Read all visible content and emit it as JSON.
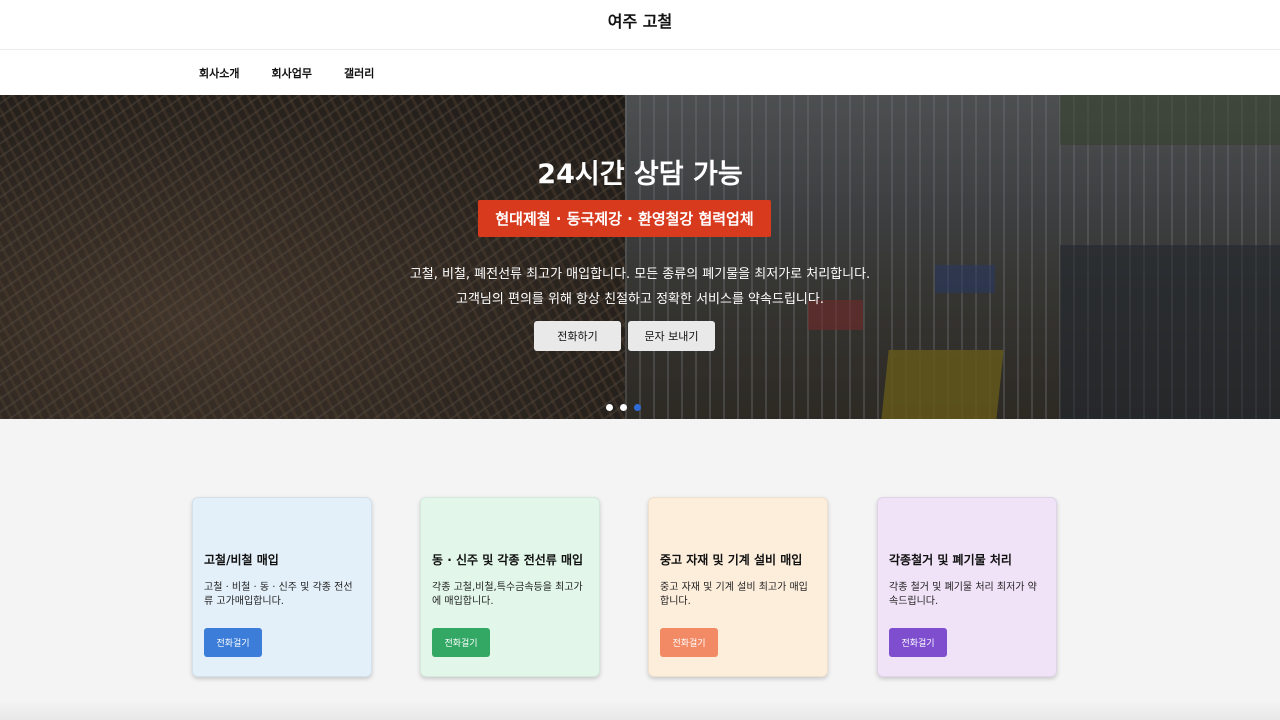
{
  "site": {
    "title": "여주 고철"
  },
  "nav": {
    "items": [
      {
        "label": "회사소개"
      },
      {
        "label": "회사업무"
      },
      {
        "label": "갤러리"
      }
    ]
  },
  "hero": {
    "headline": "24시간 상담 가능",
    "badge": "현대제철 · 동국제강 · 환영철강 협력업체",
    "description_lines": [
      "고철, 비철, 폐전선류 최고가 매입합니다. 모든 종류의 폐기물을 최저가로 처리합니다.",
      "고객님의 편의를 위해 항상 친절하고 정확한 서비스를 약속드립니다."
    ],
    "buttons": {
      "call": "전화하기",
      "sms": "문자 보내기"
    },
    "slides": {
      "count": 3,
      "active_index": 2
    }
  },
  "services": [
    {
      "title": "고철/비철 매입",
      "description": "고철 · 비철 · 동 · 신주 및 각종 전선류 고가매입합니다.",
      "button": "전화걸기",
      "bg": "#e3f0f9",
      "btn_color": "#3b7dd8"
    },
    {
      "title": "동 · 신주 및 각종 전선류 매입",
      "description": "각종 고철,비철,특수금속등을 최고가에 매입합니다.",
      "button": "전화걸기",
      "bg": "#e2f7ea",
      "btn_color": "#33a865"
    },
    {
      "title": "중고 자재 및 기계 설비 매입",
      "description": "중고 자재 및 기계 설비 최고가 매입합니다.",
      "button": "전화걸기",
      "bg": "#fdeedc",
      "btn_color": "#f38a66"
    },
    {
      "title": "각종철거 및 폐기물 처리",
      "description": "각종 철거 및 폐기물 처리 최저가 약속드립니다.",
      "button": "전화걸기",
      "bg": "#f0e2f7",
      "btn_color": "#7e4ecf"
    }
  ]
}
